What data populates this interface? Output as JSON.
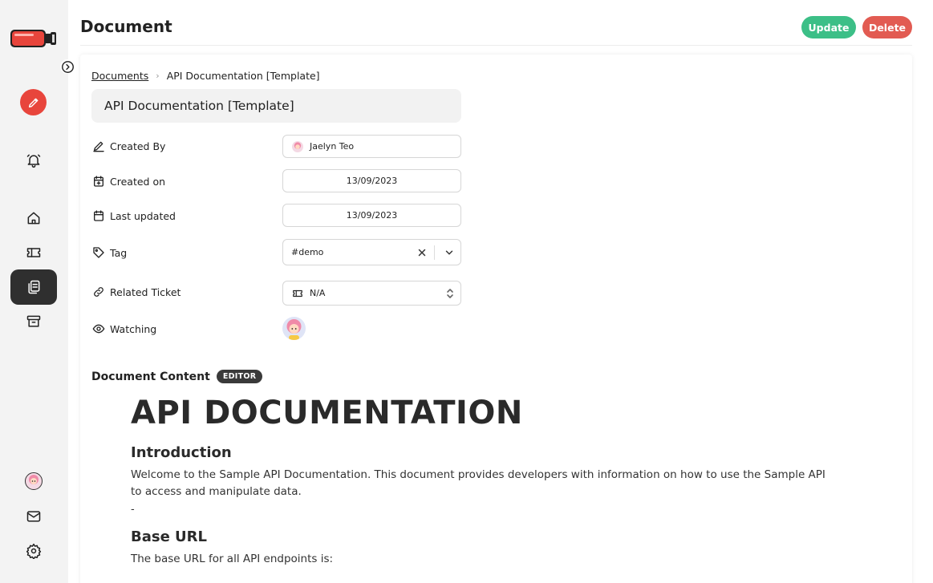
{
  "app": {
    "accent_red": "#e8453c",
    "accent_green": "#3cbf87",
    "logo": "battery-logo"
  },
  "sidebar": {
    "top_items": [
      {
        "name": "new-document",
        "icon": "pencil-icon"
      },
      {
        "name": "notifications",
        "icon": "bell-icon"
      },
      {
        "name": "home",
        "icon": "home-icon"
      },
      {
        "name": "tickets",
        "icon": "ticket-icon"
      },
      {
        "name": "documents",
        "icon": "documents-icon",
        "active": true
      },
      {
        "name": "archive",
        "icon": "archive-icon"
      }
    ],
    "bottom_items": [
      {
        "name": "profile",
        "icon": "avatar"
      },
      {
        "name": "mail",
        "icon": "mail-icon"
      },
      {
        "name": "settings",
        "icon": "gear-icon"
      }
    ]
  },
  "header": {
    "title": "Document",
    "update_label": "Update",
    "delete_label": "Delete"
  },
  "breadcrumb": {
    "root": "Documents",
    "current": "API Documentation [Template]"
  },
  "document": {
    "title": "API Documentation [Template]",
    "fields": {
      "created_by_label": "Created By",
      "created_by_value": "Jaelyn Teo",
      "created_on_label": "Created on",
      "created_on_value": "13/09/2023",
      "last_updated_label": "Last updated",
      "last_updated_value": "13/09/2023",
      "tag_label": "Tag",
      "tag_value": "#demo",
      "related_ticket_label": "Related Ticket",
      "related_ticket_value": "N/A",
      "watching_label": "Watching"
    }
  },
  "content": {
    "label": "Document Content",
    "badge": "EDITOR",
    "h1": "API DOCUMENTATION",
    "intro_heading": "Introduction",
    "intro_text": "Welcome to the Sample API Documentation. This document provides developers with information on how to use the Sample API to access and manipulate data.",
    "separator": "-",
    "base_url_heading": "Base URL",
    "base_url_text": "The base URL for all API endpoints is:"
  }
}
